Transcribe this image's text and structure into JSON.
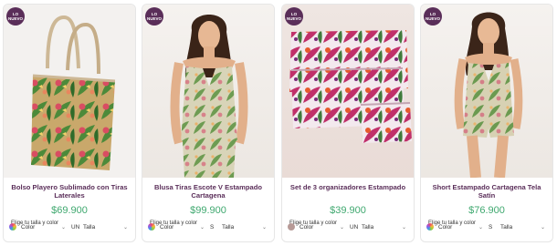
{
  "cards": [
    {
      "badge": "LO NUEVO",
      "title": "Bolso Playero Sublimado con Tiras Laterales",
      "price": "$69.900",
      "choose_label": "Elige tu talla y color",
      "color_label": "Color",
      "size_code": "UN",
      "size_label": "Talla",
      "swatch": "multicolor"
    },
    {
      "badge": "LO NUEVO",
      "title": "Blusa Tiras Escote V Estampado Cartagena",
      "price": "$99.900",
      "choose_label": "Elige tu talla y color",
      "color_label": "Color",
      "size_code": "S",
      "size_label": "Talla",
      "swatch": "multicolor"
    },
    {
      "badge": "LO NUEVO",
      "title": "Set de 3 organizadores Estampado",
      "price": "$39.900",
      "choose_label": "Elige tu talla y color",
      "color_label": "Color",
      "size_code": "UN",
      "size_label": "Talla",
      "swatch": "mauve"
    },
    {
      "badge": "LO NUEVO",
      "title": "Short Estampado Cartagena Tela Satín",
      "price": "$76.900",
      "choose_label": "Elige tu talla y color",
      "color_label": "Color",
      "size_code": "S",
      "size_label": "Talla",
      "swatch": "multicolor"
    }
  ],
  "colors": {
    "brand": "#5a2e59",
    "price": "#3fa86f",
    "badge_bg": "#5a2e59"
  }
}
